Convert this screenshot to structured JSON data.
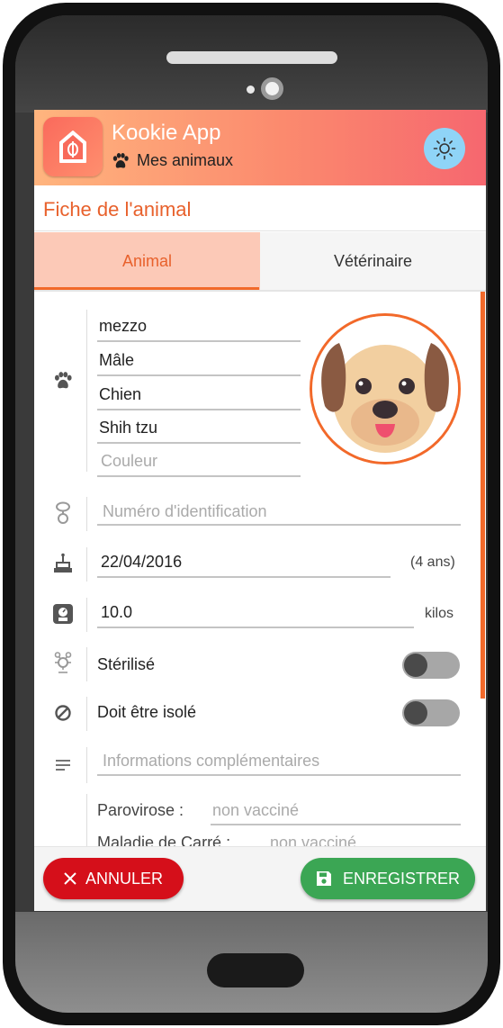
{
  "app": {
    "title": "Kookie App",
    "subtitle": "Mes animaux",
    "logo_icon": "house-icon",
    "theme_icon": "sun-icon"
  },
  "page": {
    "title": "Fiche de l'animal"
  },
  "tabs": [
    {
      "label": "Animal",
      "active": true
    },
    {
      "label": "Vétérinaire",
      "active": false
    }
  ],
  "animal": {
    "name": "mezzo",
    "sex": "Mâle",
    "species": "Chien",
    "breed": "Shih tzu",
    "color_placeholder": "Couleur",
    "id_placeholder": "Numéro d'identification",
    "birth_date": "22/04/2016",
    "age": "(4 ans)",
    "weight": "10.0",
    "weight_unit": "kilos",
    "sterilized_label": "Stérilisé",
    "sterilized": false,
    "isolated_label": "Doit être isolé",
    "isolated": false,
    "info_placeholder": "Informations complémentaires"
  },
  "vaccines": [
    {
      "name": "Parovirose :",
      "status": "non vacciné"
    },
    {
      "name": "Maladie de Carré :",
      "status": "non vacciné"
    }
  ],
  "actions": {
    "cancel_label": "ANNULER",
    "save_label": "ENREGISTRER"
  },
  "colors": {
    "accent": "#f2692a",
    "tab_active_bg": "#fcc9b7",
    "cancel": "#d50f1a",
    "save": "#3ba654",
    "theme_button": "#8fd4f7"
  }
}
